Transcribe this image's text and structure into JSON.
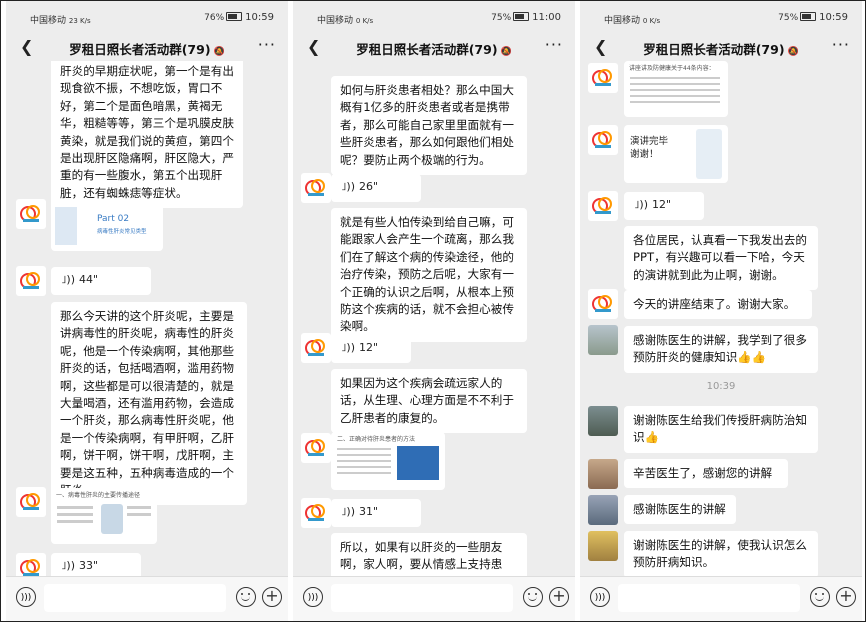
{
  "panels": [
    {
      "status": {
        "carrier": "中国移动",
        "net": "23 K/s",
        "battery": "76%",
        "time": "10:59"
      },
      "title": "罗租日照长者活动群(79)",
      "messages": {
        "m1": "肝炎的早期症状呢，第一个是有出现食欲不振，不想吃饭，胃口不好，第二个是面色暗黑，黄褐无华，粗糙等等，第三个是巩膜皮肤黄染，就是我们说的黄疸，第四个是出现肝区隐痛啊，肝区隐大，严重的有一些腹水，第五个出现肝脏，还有蜘蛛痣等症状。",
        "card_title": "Part 02",
        "card_sub": "病毒性肝炎常见类型",
        "voice1": "44\"",
        "m2": "那么今天讲的这个肝炎呢，主要是讲病毒性的肝炎呢，病毒性的肝炎呢，他是一个传染病啊，其他那些肝炎的话，包括喝酒啊，滥用药物啊，这些都是可以很清楚的，就是大量喝酒，还有滥用药物，会造成一个肝炎，那么病毒性肝炎呢，他是一个传染病啊，有甲肝啊，乙肝啊，饼干啊，饼干啊，戊肝啊，主要是这五种，五种病毒造成的一个肝炎。",
        "card2_title": "一、病毒性肝炎的主要传播途径",
        "voice2": "33\""
      }
    },
    {
      "status": {
        "carrier": "中国移动",
        "net": "0 K/s",
        "battery": "75%",
        "time": "11:00"
      },
      "title": "罗租日照长者活动群(79)",
      "messages": {
        "m1": "如何与肝炎患者相处？那么中国大概有1亿多的肝炎患者或者是携带者，那么可能自己家里里面就有一些肝炎患者，那么如何跟他们相处呢？要防止两个极端的行为。",
        "voice1": "26\"",
        "m2": "就是有些人怕传染到给自己嘛，可能跟家人会产生一个疏离，那么我们在了解这个病的传染途径，他的治疗传染，预防之后呢，大家有一个正确的认识之后啊，从根本上预防这个疾病的话，就不会担心被传染啊。",
        "voice2": "12\"",
        "m3": "如果因为这个疾病会疏远家人的话，从生理、心理方面是不不利于乙肝患者的康复的。",
        "card_title": "二、正确对待肝炎患者的方法",
        "voice3": "31\"",
        "m4": "所以，如果有以肝炎的一些朋友啊，家人啊，要从情感上支持患者，拉近与患者的距离，多以关心，鼓励"
      }
    },
    {
      "status": {
        "carrier": "中国移动",
        "net": "0 K/s",
        "battery": "75%",
        "time": "10:59"
      },
      "title": "罗租日照长者活动群(79)",
      "messages": {
        "card_top": "讲座讲及防健康关于44条内容：",
        "card_end": "演讲完毕\n谢谢！",
        "voice1": "12\"",
        "m1": "各位居民，认真看一下我发出去的PPT，有兴趣可以看一下哈，今天的演讲就到此为止啊，谢谢。",
        "m2": "今天的讲座结束了。谢谢大家。",
        "m3": "感谢陈医生的讲解，我学到了很多预防肝炎的健康知识👍👍",
        "time": "10:39",
        "m4": "谢谢陈医生给我们传授肝病防治知识👍",
        "m5": "辛苦医生了，感谢您的讲解",
        "m6": "感谢陈医生的讲解",
        "m7": "谢谢陈医生的讲解，使我认识怎么预防肝病知识。"
      }
    }
  ]
}
